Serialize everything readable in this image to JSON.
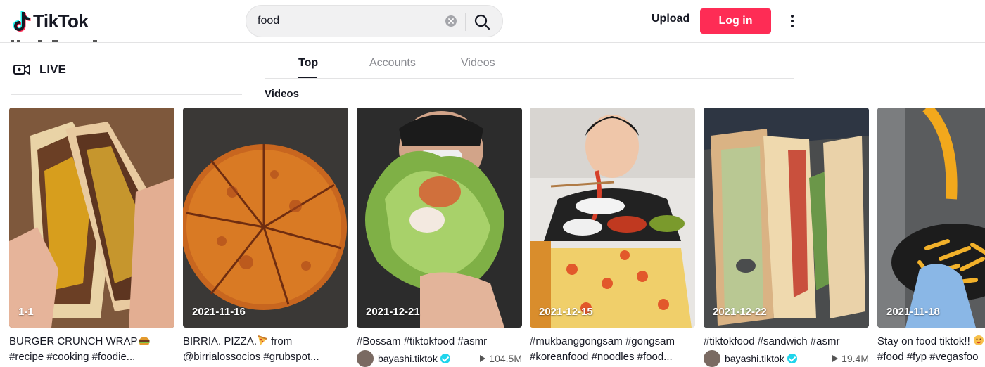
{
  "header": {
    "logo_text": "TikTok",
    "search": {
      "value": "food"
    },
    "upload_label": "Upload",
    "login_label": "Log in"
  },
  "sidebar": {
    "live_label": "LIVE"
  },
  "tabs": [
    {
      "label": "Top",
      "active": true
    },
    {
      "label": "Accounts",
      "active": false
    },
    {
      "label": "Videos",
      "active": false
    }
  ],
  "section_title": "Videos",
  "videos": [
    {
      "date": "1-1",
      "line1": "BURGER CRUNCH WRAP",
      "line1_emoji": "burger",
      "line2": "#recipe #cooking #foodie..."
    },
    {
      "date": "2021-11-16",
      "line1": "BIRRIA. PIZZA.",
      "line1_emoji": "pizza",
      "line1_tail": " from",
      "line2": "@birrialossocios #grubspot..."
    },
    {
      "date": "2021-12-21",
      "line1": "#Bossam #tiktokfood #asmr",
      "author": "bayashi.tiktok",
      "views": "104.5M"
    },
    {
      "date": "2021-12-15",
      "line1": "#mukbanggongsam #gongsam",
      "line2": "#koreanfood #noodles #food..."
    },
    {
      "date": "2021-12-22",
      "line1": "#tiktokfood #sandwich #asmr",
      "author": "bayashi.tiktok",
      "views": "19.4M"
    },
    {
      "date": "2021-11-18",
      "line1": "Stay on food tiktok!!",
      "line2": "#food #fyp #vegasfoo"
    }
  ],
  "colors": {
    "brand": "#fe2c55",
    "verified": "#20d5ec"
  }
}
